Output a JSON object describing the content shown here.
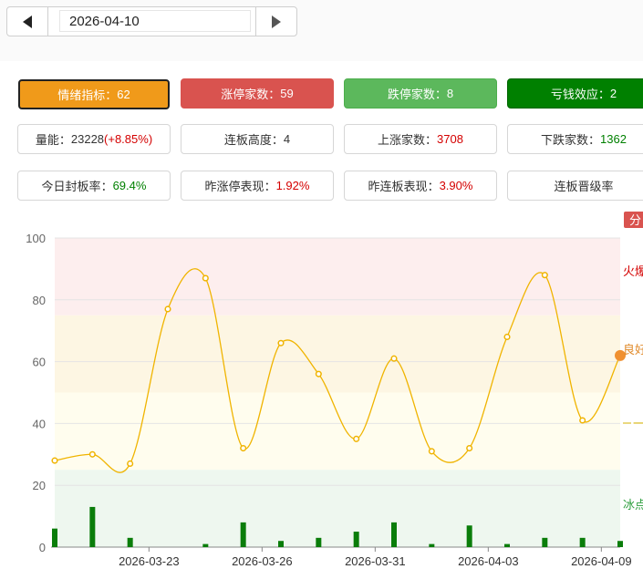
{
  "date_picker": {
    "value": "2026-04-10"
  },
  "cards_row1": [
    {
      "label": "情绪指标",
      "value": "62"
    },
    {
      "label": "涨停家数",
      "value": "59"
    },
    {
      "label": "跌停家数",
      "value": "8"
    },
    {
      "label": "亏钱效应",
      "value": "2"
    }
  ],
  "cards_row2": [
    {
      "label": "量能",
      "value": "23228",
      "extra": "(+8.85%)"
    },
    {
      "label": "连板高度",
      "value": "4"
    },
    {
      "label": "上涨家数",
      "value": "3708"
    },
    {
      "label": "下跌家数",
      "value": "1362"
    }
  ],
  "cards_row3": [
    {
      "label": "今日封板率",
      "value": "69.4%"
    },
    {
      "label": "昨涨停表现",
      "value": "1.92%"
    },
    {
      "label": "昨连板表现",
      "value": "3.90%"
    },
    {
      "label": "连板晋级率",
      "value": ""
    }
  ],
  "separator": "：",
  "chart_data": {
    "type": "line",
    "ylim": [
      0,
      100
    ],
    "yticks": [
      "0",
      "20",
      "40",
      "60",
      "80",
      "100"
    ],
    "xtick_labels": [
      "2026-03-23",
      "2026-03-26",
      "2026-03-31",
      "2026-04-03",
      "2026-04-09"
    ],
    "bands": [
      {
        "label": "火爆",
        "from": 75,
        "to": 100,
        "color": "#fdeeee"
      },
      {
        "label": "良好",
        "from": 50,
        "to": 75,
        "color": "#fdf6e3"
      },
      {
        "label": "一般",
        "from": 25,
        "to": 50,
        "color": "#fffdee"
      },
      {
        "label": "冰点",
        "from": 0,
        "to": 25,
        "color": "#eef7ef"
      }
    ],
    "band_label_colors": [
      "#d40000",
      "#e08a2a",
      "#d4b000",
      "#2e9e3e"
    ],
    "corner_badge": "分",
    "series": [
      {
        "type": "line",
        "color": "#f0b400",
        "values": [
          28,
          30,
          27,
          77,
          87,
          32,
          66,
          56,
          35,
          61,
          31,
          32,
          68,
          88,
          41,
          62
        ]
      },
      {
        "type": "bar",
        "color": "#0a7d0a",
        "values": [
          6,
          13,
          3,
          0,
          1,
          8,
          2,
          3,
          5,
          8,
          1,
          7,
          1,
          3,
          3,
          2
        ]
      }
    ],
    "highlight_color": "#f09030"
  }
}
